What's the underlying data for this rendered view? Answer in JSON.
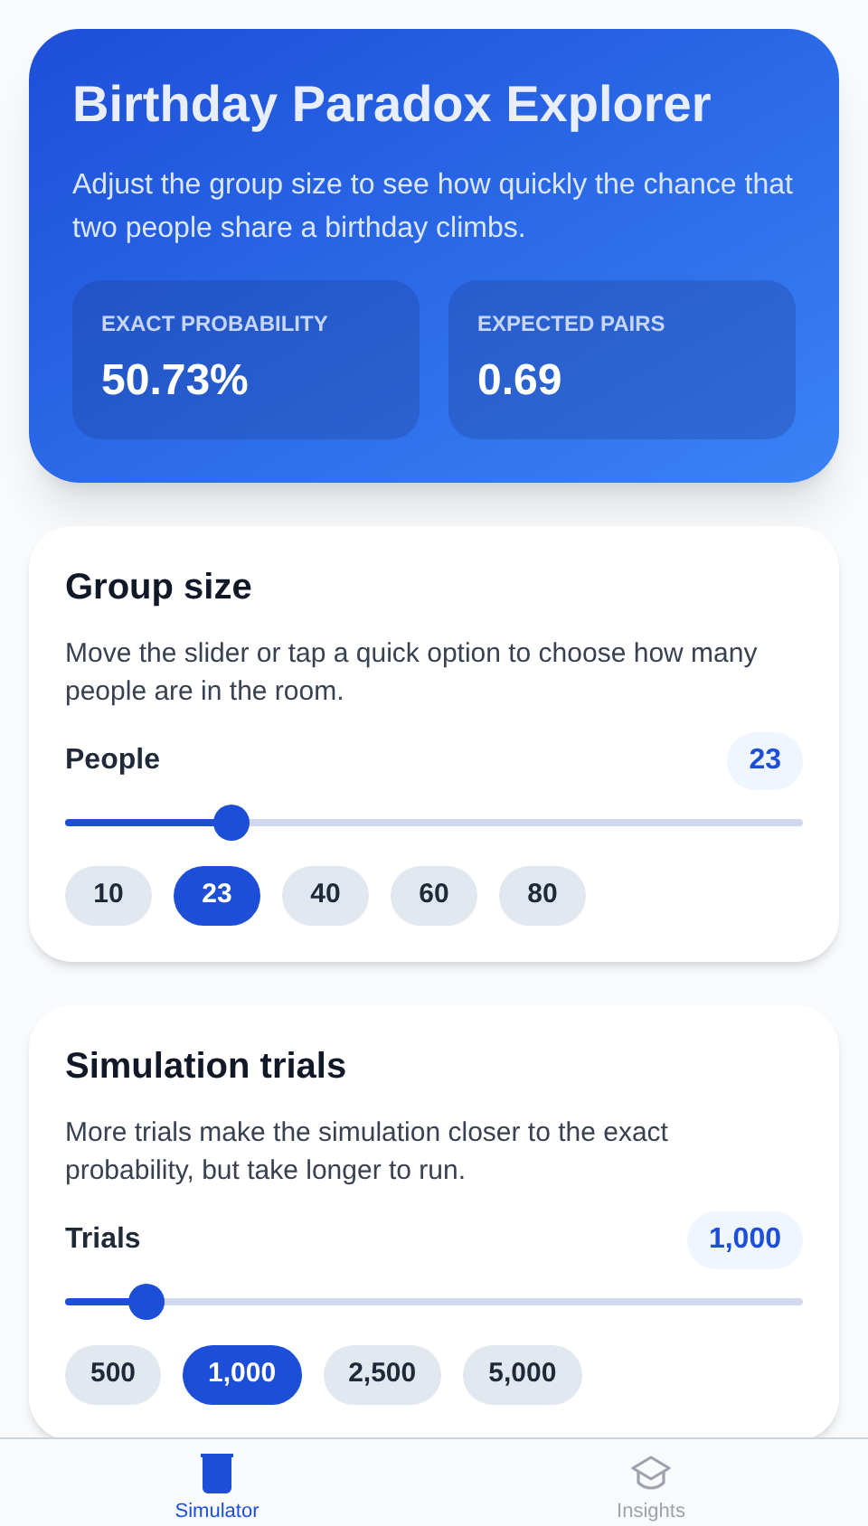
{
  "header": {
    "title": "Birthday Paradox Explorer",
    "description": "Adjust the group size to see how quickly the chance that two people share a birthday climbs.",
    "stats": [
      {
        "label": "EXACT PROBABILITY",
        "value": "50.73%"
      },
      {
        "label": "EXPECTED PAIRS",
        "value": "0.69"
      }
    ]
  },
  "cards": [
    {
      "title": "Group size",
      "description": "Move the slider or tap a quick option to choose how many people are in the room.",
      "label": "People",
      "value": "23",
      "level": 0.225,
      "options": [
        {
          "label": "10",
          "selected": false
        },
        {
          "label": "23",
          "selected": true
        },
        {
          "label": "40",
          "selected": false
        },
        {
          "label": "60",
          "selected": false
        },
        {
          "label": "80",
          "selected": false
        }
      ]
    },
    {
      "title": "Simulation trials",
      "description": "More trials make the simulation closer to the exact probability, but take longer to run.",
      "label": "Trials",
      "value": "1,000",
      "level": 0.11,
      "options": [
        {
          "label": "500",
          "selected": false
        },
        {
          "label": "1,000",
          "selected": true
        },
        {
          "label": "2,500",
          "selected": false
        },
        {
          "label": "5,000",
          "selected": false
        }
      ]
    }
  ],
  "nav": [
    {
      "kind": "beaker",
      "label": "Simulator",
      "selected": true
    },
    {
      "kind": "cap",
      "label": "Insights",
      "selected": false
    }
  ]
}
